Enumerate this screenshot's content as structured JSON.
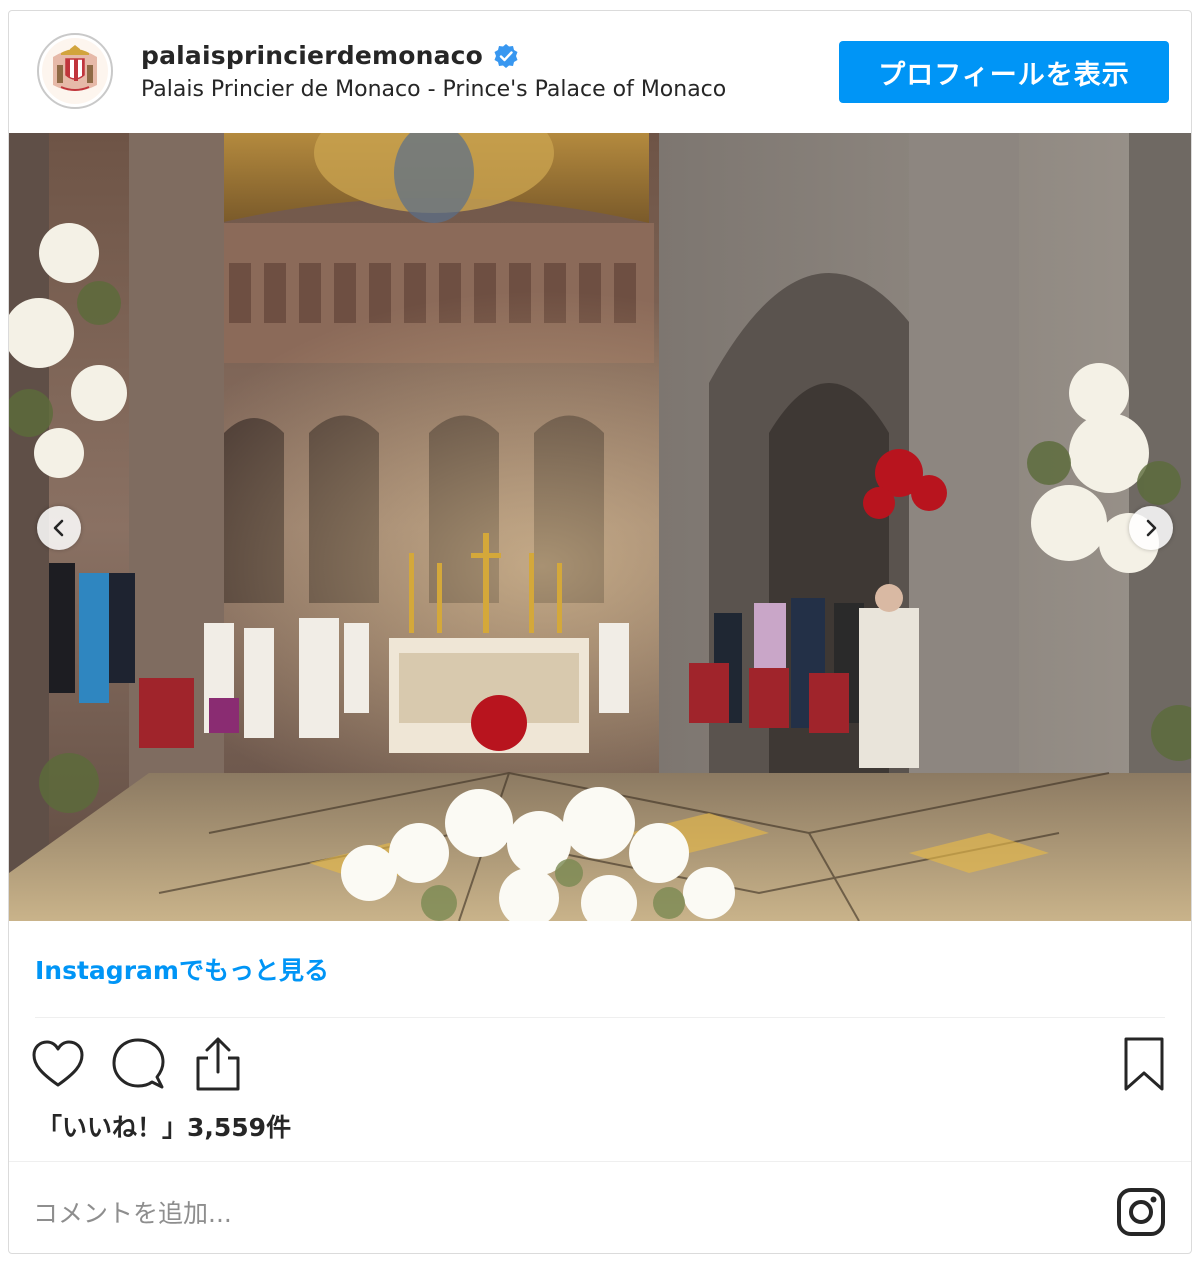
{
  "post": {
    "username": "palaisprincierdemonaco",
    "full_name": "Palais Princier de Monaco - Prince's Palace of Monaco",
    "profile_button": "プロフィールを表示",
    "more_link": "Instagramでもっと見る",
    "likes_text": "「いいね！」3,559件",
    "comment_placeholder": "コメントを追加...",
    "verified": true
  },
  "icons": {
    "avatar": "coat-of-arms-avatar",
    "verified": "verified-badge-icon",
    "prev": "chevron-left-icon",
    "next": "chevron-right-icon",
    "like": "heart-icon",
    "comment": "comment-bubble-icon",
    "share": "share-icon",
    "save": "bookmark-icon",
    "brand": "instagram-icon"
  },
  "colors": {
    "accent": "#0095f6",
    "text": "#262626",
    "muted": "#8e8e8e",
    "border": "#dbdbdb"
  }
}
